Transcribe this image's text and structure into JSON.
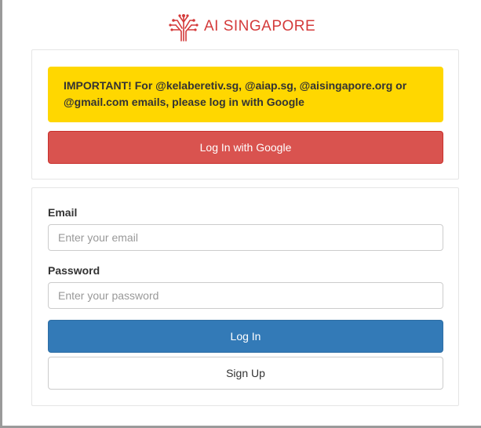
{
  "logo": {
    "icon": "circuit-tree-logo",
    "text": "AI SINGAPORE",
    "color": "#d43a3a"
  },
  "notice": {
    "text": "IMPORTANT! For @kelaberetiv.sg, @aiap.sg, @aisingapore.org or @gmail.com emails, please log in with Google",
    "background": "#ffd700"
  },
  "google_button": {
    "label": "Log In with Google",
    "color": "#d9534f"
  },
  "form": {
    "email_label": "Email",
    "email_placeholder": "Enter your email",
    "email_value": "",
    "password_label": "Password",
    "password_placeholder": "Enter your password",
    "password_value": "",
    "login_label": "Log In",
    "login_color": "#337ab7",
    "signup_label": "Sign Up"
  }
}
